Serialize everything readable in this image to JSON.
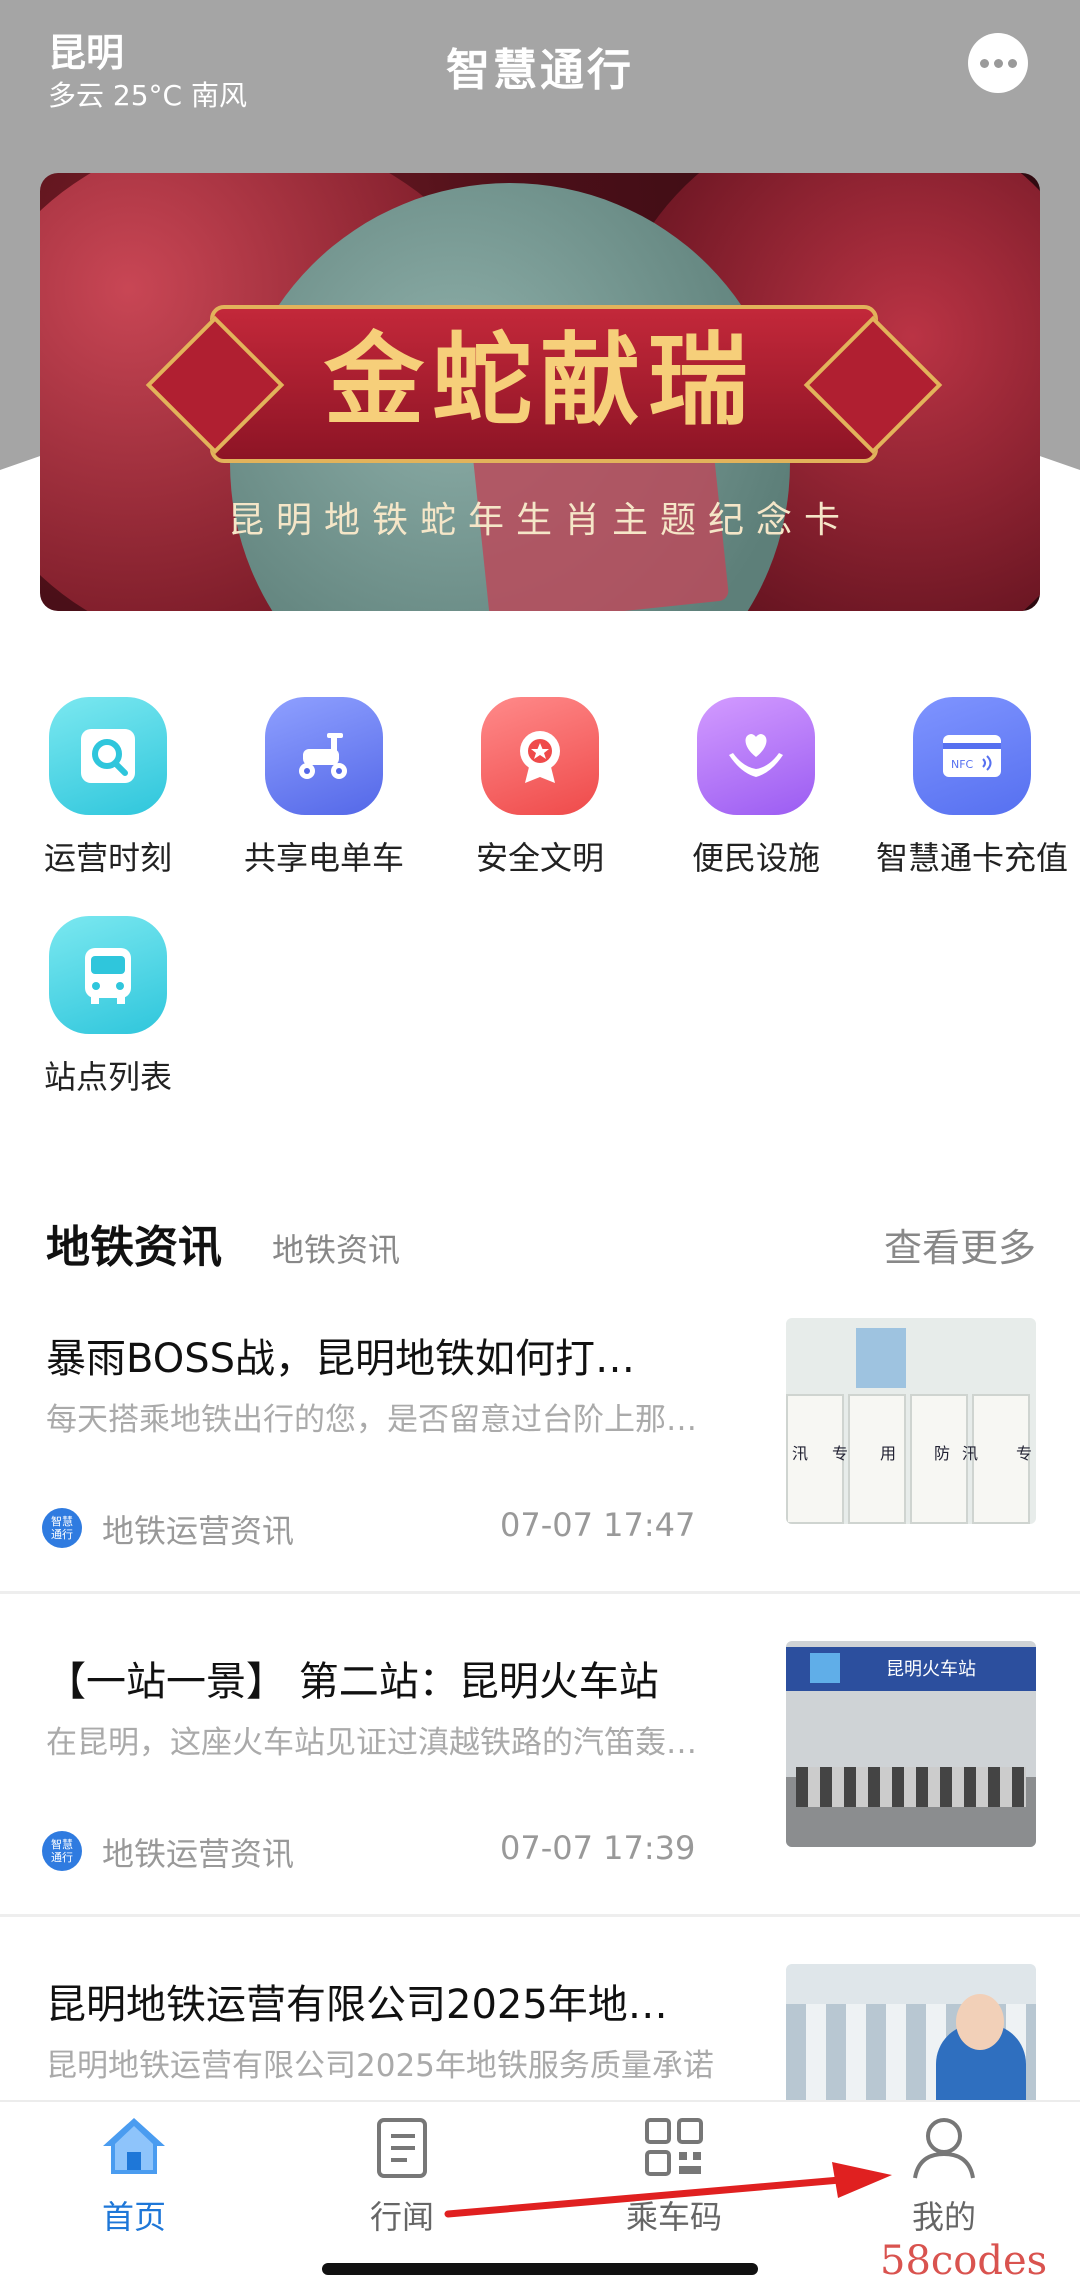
{
  "header": {
    "city": "昆明",
    "weather": "多云 25°C 南风",
    "title": "智慧通行",
    "message_icon": "more-dots-icon"
  },
  "banner": {
    "headline": "金蛇献瑞",
    "subline": "昆明地铁蛇年生肖主题纪念卡"
  },
  "services": [
    {
      "label": "运营时刻",
      "icon": "search-icon",
      "color": "#2fc6dc"
    },
    {
      "label": "共享电单车",
      "icon": "scooter-icon",
      "color": "#5468e8"
    },
    {
      "label": "安全文明",
      "icon": "badge-icon",
      "color": "#ef4a4a"
    },
    {
      "label": "便民设施",
      "icon": "heart-hands-icon",
      "color": "#9b5cf2"
    },
    {
      "label": "智慧通卡充值",
      "icon": "nfc-card-icon",
      "color": "#5670f0"
    },
    {
      "label": "站点列表",
      "icon": "bus-icon",
      "color": "#2fc6dc"
    }
  ],
  "news_section": {
    "title": "地铁资讯",
    "subtitle": "地铁资讯",
    "more": "查看更多"
  },
  "news": [
    {
      "title": "暴雨BOSS战，昆明地铁如何打…",
      "desc": "每天搭乘地铁出行的您，是否留意过台阶上那…",
      "source_icon": "智慧通行",
      "source": "地铁运营资讯",
      "time": "07-07 17:47",
      "thumb": {
        "labels": [
          "汛",
          "专",
          "用",
          "防",
          "汛",
          "专"
        ]
      }
    },
    {
      "title": "【一站一景】 第二站：昆明火车站",
      "desc": "在昆明，这座火车站见证过滇越铁路的汽笛轰…",
      "source_icon": "智慧通行",
      "source": "地铁运营资讯",
      "time": "07-07 17:39",
      "thumb": {
        "sign": "昆明火车站"
      }
    },
    {
      "title": "昆明地铁运营有限公司2025年地…",
      "desc": "昆明地铁运营有限公司2025年地铁服务质量承诺",
      "source_icon": "",
      "source": "",
      "time": "",
      "thumb": {}
    }
  ],
  "tabbar": {
    "items": [
      {
        "label": "首页",
        "icon": "home-icon",
        "active": true
      },
      {
        "label": "行闻",
        "icon": "news-icon",
        "active": false
      },
      {
        "label": "乘车码",
        "icon": "qr-code-icon",
        "active": false
      },
      {
        "label": "我的",
        "icon": "user-icon",
        "active": false
      }
    ],
    "active_color": "#1e77d8"
  },
  "annotation": {
    "arrow_color": "#e02020"
  },
  "watermark": "58codes"
}
